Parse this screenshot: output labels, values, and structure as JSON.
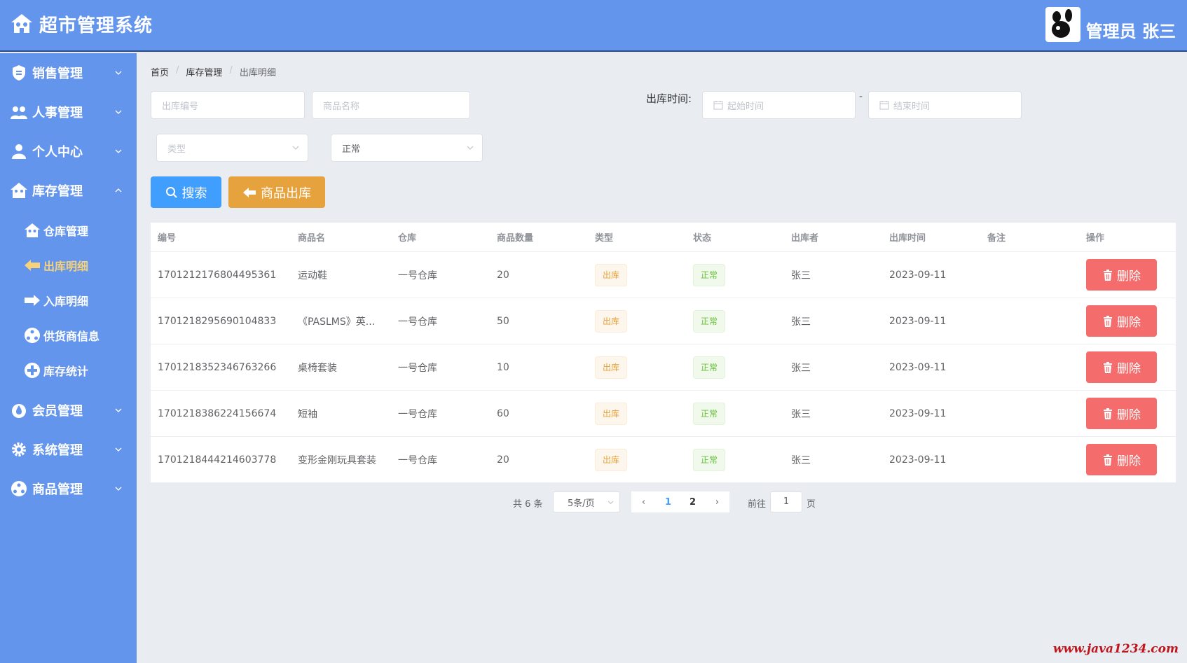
{
  "app": {
    "title": "超市管理系统",
    "user_label": "管理员 张三"
  },
  "sidebar": {
    "items": [
      {
        "label": "销售管理",
        "icon": "shield-icon"
      },
      {
        "label": "人事管理",
        "icon": "people-icon"
      },
      {
        "label": "个人中心",
        "icon": "person-icon"
      },
      {
        "label": "库存管理",
        "icon": "house-icon",
        "expanded": true
      }
    ],
    "submenu": [
      {
        "label": "仓库管理",
        "icon": "warehouse-icon"
      },
      {
        "label": "出库明细",
        "icon": "arrow-left-icon",
        "active": true
      },
      {
        "label": "入库明细",
        "icon": "arrow-right-icon"
      },
      {
        "label": "供货商信息",
        "icon": "network-icon"
      },
      {
        "label": "库存统计",
        "icon": "plus-circle-icon"
      }
    ],
    "items_after": [
      {
        "label": "会员管理",
        "icon": "drop-icon"
      },
      {
        "label": "系统管理",
        "icon": "gear-icon"
      },
      {
        "label": "商品管理",
        "icon": "network-icon"
      }
    ]
  },
  "breadcrumb": [
    "首页",
    "库存管理",
    "出库明细"
  ],
  "filters": {
    "out_no_placeholder": "出库编号",
    "goods_name_placeholder": "商品名称",
    "time_label": "出库时间:",
    "start_placeholder": "起始时间",
    "end_placeholder": "结束时间",
    "range_sep": "-",
    "type_placeholder": "类型",
    "status_value": "正常"
  },
  "buttons": {
    "search": "搜索",
    "goods_out": "商品出库",
    "delete": "删除"
  },
  "table": {
    "columns": [
      "编号",
      "商品名",
      "仓库",
      "商品数量",
      "类型",
      "状态",
      "出库者",
      "出库时间",
      "备注",
      "操作"
    ],
    "rows": [
      {
        "id": "1701212176804495361",
        "name": "运动鞋",
        "warehouse": "一号仓库",
        "qty": "20",
        "type": "出库",
        "status": "正常",
        "operator": "张三",
        "time": "2023-09-11",
        "note": ""
      },
      {
        "id": "1701218295690104833",
        "name": "《PASLMS》英...",
        "warehouse": "一号仓库",
        "qty": "50",
        "type": "出库",
        "status": "正常",
        "operator": "张三",
        "time": "2023-09-11",
        "note": ""
      },
      {
        "id": "1701218352346763266",
        "name": "桌椅套装",
        "warehouse": "一号仓库",
        "qty": "10",
        "type": "出库",
        "status": "正常",
        "operator": "张三",
        "time": "2023-09-11",
        "note": ""
      },
      {
        "id": "1701218386224156674",
        "name": "短袖",
        "warehouse": "一号仓库",
        "qty": "60",
        "type": "出库",
        "status": "正常",
        "operator": "张三",
        "time": "2023-09-11",
        "note": ""
      },
      {
        "id": "1701218444214603778",
        "name": "变形金刚玩具套装",
        "warehouse": "一号仓库",
        "qty": "20",
        "type": "出库",
        "status": "正常",
        "operator": "张三",
        "time": "2023-09-11",
        "note": ""
      }
    ]
  },
  "pagination": {
    "total": "共 6 条",
    "page_size": "5条/页",
    "pages": [
      "1",
      "2"
    ],
    "current": "1",
    "goto_label": "前往",
    "goto_value": "1",
    "page_suffix": "页",
    "prev": "‹",
    "next": "›"
  },
  "watermark": "www.java1234.com",
  "colors": {
    "header": "#6495ed",
    "primary": "#409eff",
    "warning": "#e6a23c",
    "danger": "#f56c6c",
    "success": "#67c23a"
  }
}
